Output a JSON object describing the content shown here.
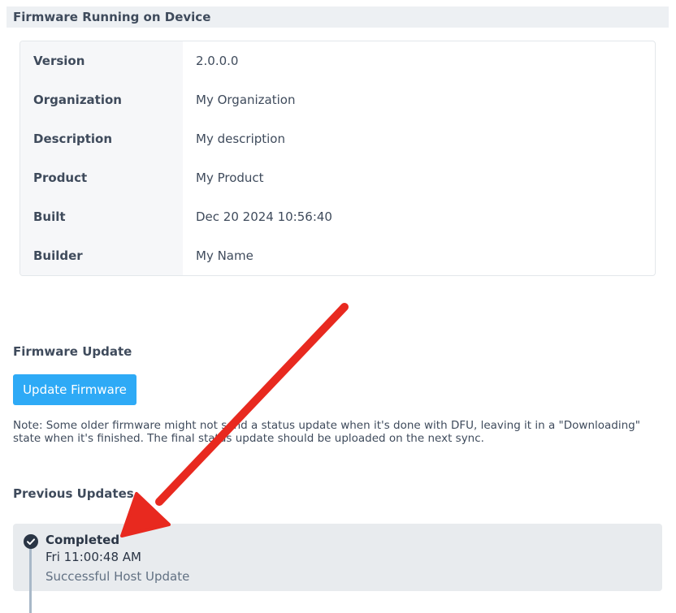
{
  "colors": {
    "accent": "#2eaaf6",
    "header_bg": "#edf0f3",
    "card_bg": "#e8ebee",
    "text": "#3f4b5c",
    "annotation_arrow": "#e8291f"
  },
  "firmware_section": {
    "title": "Firmware Running on Device",
    "rows": [
      {
        "label": "Version",
        "value": "2.0.0.0"
      },
      {
        "label": "Organization",
        "value": "My Organization"
      },
      {
        "label": "Description",
        "value": "My description"
      },
      {
        "label": "Product",
        "value": "My Product"
      },
      {
        "label": "Built",
        "value": "Dec 20 2024 10:56:40"
      },
      {
        "label": "Builder",
        "value": "My Name"
      }
    ]
  },
  "firmware_update": {
    "title": "Firmware Update",
    "button_label": "Update Firmware",
    "note": "Note: Some older firmware might not send a status update when it's done with DFU, leaving it in a \"Downloading\" state when it's finished. The final status update should be uploaded on the next sync."
  },
  "previous_updates": {
    "title": "Previous Updates",
    "items": [
      {
        "status": "Completed",
        "time": "Fri 11:00:48 AM",
        "description": "Successful Host Update",
        "icon": "check-circle-icon"
      }
    ]
  }
}
